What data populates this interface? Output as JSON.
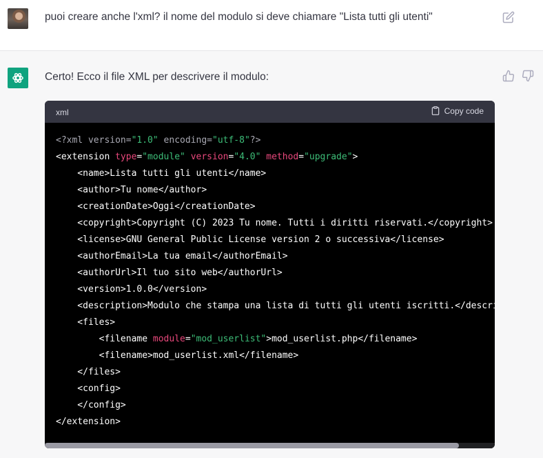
{
  "user_message": {
    "text": "puoi creare anche l'xml? il nome del modulo si deve chiamare \"Lista tutti gli utenti\""
  },
  "assistant_message": {
    "intro": "Certo! Ecco il file XML per descrivere il modulo:",
    "code_block": {
      "language": "xml",
      "copy_label": "Copy code",
      "lines": [
        [
          {
            "t": "<?xml version=",
            "c": "#a9a9b3"
          },
          {
            "t": "\"1.0\"",
            "c": "#3dbd78"
          },
          {
            "t": " encoding=",
            "c": "#a9a9b3"
          },
          {
            "t": "\"utf-8\"",
            "c": "#3dbd78"
          },
          {
            "t": "?>",
            "c": "#a9a9b3"
          }
        ],
        [
          {
            "t": "<extension ",
            "c": "#ffffff"
          },
          {
            "t": "type",
            "c": "#e9487c"
          },
          {
            "t": "=",
            "c": "#ffffff"
          },
          {
            "t": "\"module\"",
            "c": "#3dbd78"
          },
          {
            "t": " ",
            "c": "#ffffff"
          },
          {
            "t": "version",
            "c": "#e9487c"
          },
          {
            "t": "=",
            "c": "#ffffff"
          },
          {
            "t": "\"4.0\"",
            "c": "#3dbd78"
          },
          {
            "t": " ",
            "c": "#ffffff"
          },
          {
            "t": "method",
            "c": "#e9487c"
          },
          {
            "t": "=",
            "c": "#ffffff"
          },
          {
            "t": "\"upgrade\"",
            "c": "#3dbd78"
          },
          {
            "t": ">",
            "c": "#ffffff"
          }
        ],
        [
          {
            "t": "    <name>Lista tutti gli utenti</name>",
            "c": "#ffffff"
          }
        ],
        [
          {
            "t": "    <author>Tu nome</author>",
            "c": "#ffffff"
          }
        ],
        [
          {
            "t": "    <creationDate>Oggi</creationDate>",
            "c": "#ffffff"
          }
        ],
        [
          {
            "t": "    <copyright>Copyright (C) 2023 Tu nome. Tutti i diritti riservati.</copyright>",
            "c": "#ffffff"
          }
        ],
        [
          {
            "t": "    <license>GNU General Public License version 2 o successiva</license>",
            "c": "#ffffff"
          }
        ],
        [
          {
            "t": "    <authorEmail>La tua email</authorEmail>",
            "c": "#ffffff"
          }
        ],
        [
          {
            "t": "    <authorUrl>Il tuo sito web</authorUrl>",
            "c": "#ffffff"
          }
        ],
        [
          {
            "t": "    <version>1.0.0</version>",
            "c": "#ffffff"
          }
        ],
        [
          {
            "t": "    <description>Modulo che stampa una lista di tutti gli utenti iscritti.</descrip",
            "c": "#ffffff"
          }
        ],
        [
          {
            "t": "    <files>",
            "c": "#ffffff"
          }
        ],
        [
          {
            "t": "        <filename ",
            "c": "#ffffff"
          },
          {
            "t": "module",
            "c": "#e9487c"
          },
          {
            "t": "=",
            "c": "#ffffff"
          },
          {
            "t": "\"mod_userlist\"",
            "c": "#3dbd78"
          },
          {
            "t": ">mod_userlist.php</filename>",
            "c": "#ffffff"
          }
        ],
        [
          {
            "t": "        <filename>mod_userlist.xml</filename>",
            "c": "#ffffff"
          }
        ],
        [
          {
            "t": "    </files>",
            "c": "#ffffff"
          }
        ],
        [
          {
            "t": "    <config>",
            "c": "#ffffff"
          }
        ],
        [
          {
            "t": "    </config>",
            "c": "#ffffff"
          }
        ],
        [
          {
            "t": "</extension>",
            "c": "#ffffff"
          }
        ]
      ]
    }
  },
  "icons": {
    "user_avatar": "user-avatar",
    "assistant_avatar": "openai-logo-icon",
    "edit": "edit-icon",
    "thumbs_up": "thumbs-up-icon",
    "thumbs_down": "thumbs-down-icon",
    "copy": "clipboard-icon"
  },
  "colors": {
    "assistant_bg": "#f7f7f8",
    "code_bg": "#000000",
    "code_header_bg": "#343541",
    "brand_green": "#10a37f",
    "xml_attr": "#e9487c",
    "xml_string": "#3dbd78"
  }
}
